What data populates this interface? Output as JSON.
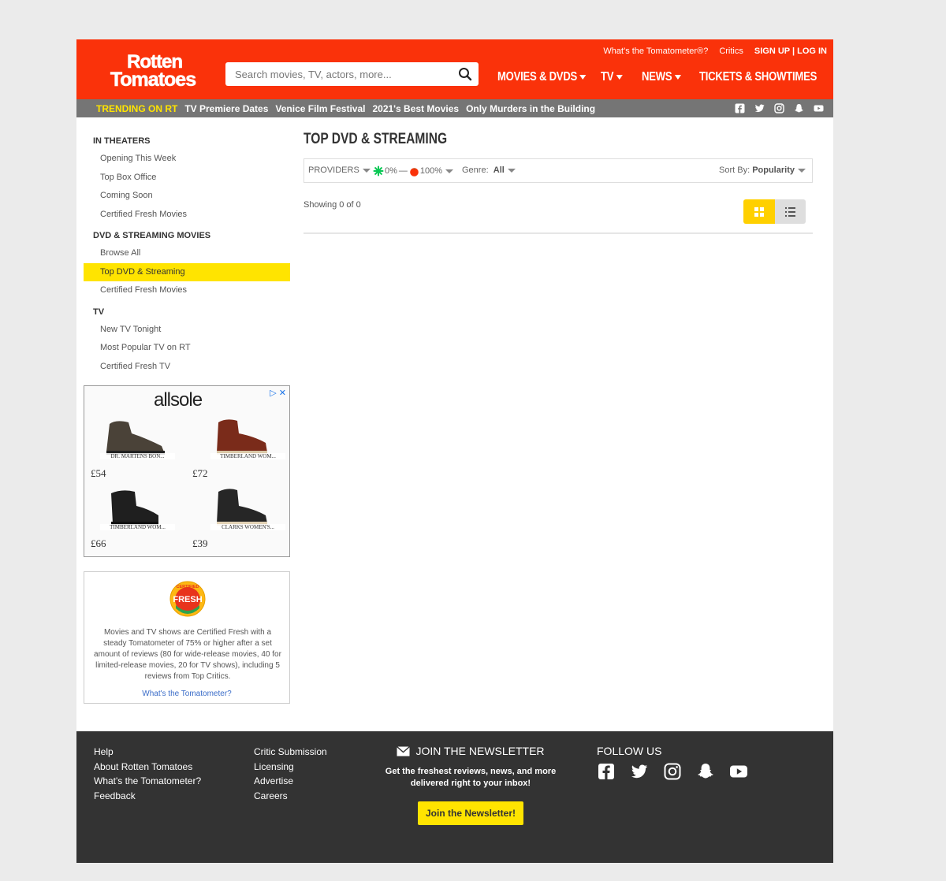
{
  "brand": {
    "logo_line1": "Rotten",
    "logo_line2": "Tomatoes"
  },
  "search": {
    "placeholder": "Search movies, TV, actors, more..."
  },
  "top_links": {
    "tomatometer": "What's the Tomatometer®?",
    "critics": "Critics",
    "auth": "SIGN UP | LOG IN"
  },
  "main_nav": [
    {
      "label": "MOVIES & DVDS"
    },
    {
      "label": "TV"
    },
    {
      "label": "NEWS"
    },
    {
      "label": "TICKETS & SHOWTIMES"
    }
  ],
  "trending": {
    "label": "TRENDING ON RT",
    "items": [
      "TV Premiere Dates",
      "Venice Film Festival",
      "2021's Best Movies",
      "Only Murders in the Building"
    ]
  },
  "sidebar": {
    "sections": [
      {
        "heading": "IN THEATERS",
        "items": [
          "Opening This Week",
          "Top Box Office",
          "Coming Soon",
          "Certified Fresh Movies"
        ]
      },
      {
        "heading": "DVD & STREAMING MOVIES",
        "items": [
          "Browse All",
          "Top DVD & Streaming",
          "Certified Fresh Movies"
        ]
      },
      {
        "heading": "TV",
        "items": [
          "New TV Tonight",
          "Most Popular TV on RT",
          "Certified Fresh TV"
        ]
      }
    ],
    "active_item": "Top DVD & Streaming"
  },
  "ad": {
    "brand": "allsole",
    "products": [
      {
        "name": "DR. MARTENS BON...",
        "price": "£54"
      },
      {
        "name": "TIMBERLAND WOM...",
        "price": "£72"
      },
      {
        "name": "TIMBERLAND WOM...",
        "price": "£66"
      },
      {
        "name": "CLARKS WOMEN'S...",
        "price": "£39"
      }
    ]
  },
  "certified_fresh": {
    "badge_top": "CERTIFIED",
    "badge_main": "FRESH",
    "text": "Movies and TV shows are Certified Fresh with a steady Tomatometer of 75% or higher after a set amount of reviews (80 for wide-release movies, 40 for limited-release movies, 20 for TV shows), including 5 reviews from Top Critics.",
    "link": "What's the Tomatometer?"
  },
  "page": {
    "title": "TOP DVD & STREAMING",
    "filters": {
      "providers": "PROVIDERS",
      "score_min": "0%",
      "dash": "—",
      "score_max": "100%",
      "genre_label": "Genre:",
      "genre_value": "All",
      "sort_label": "Sort By:",
      "sort_value": "Popularity"
    },
    "showing": "Showing 0 of 0"
  },
  "footer": {
    "col1": [
      "Help",
      "About Rotten Tomatoes",
      "What's the Tomatometer?",
      "Feedback"
    ],
    "col2": [
      "Critic Submission",
      "Licensing",
      "Advertise",
      "Careers"
    ],
    "newsletter": {
      "heading": "JOIN THE NEWSLETTER",
      "description": "Get the freshest reviews, news, and more delivered right to your inbox!",
      "button": "Join the Newsletter!"
    },
    "follow": {
      "heading": "FOLLOW US",
      "icons": [
        "facebook-icon",
        "twitter-icon",
        "instagram-icon",
        "snapchat-icon",
        "youtube-icon"
      ]
    }
  },
  "colors": {
    "header": "#fa320a",
    "trending_bar": "#757575",
    "accent_yellow": "#ffe400",
    "footer": "#333333"
  }
}
